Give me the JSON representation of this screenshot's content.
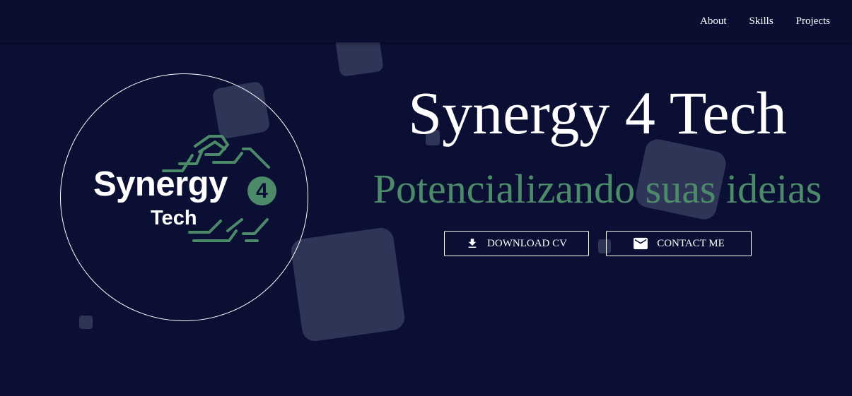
{
  "nav": {
    "links": [
      "About",
      "Skills",
      "Projects"
    ]
  },
  "logo": {
    "word": "Synergy",
    "badge": "4",
    "sub": "Tech"
  },
  "hero": {
    "title": "Synergy 4 Tech",
    "subtitle": "Potencializando suas ideias"
  },
  "buttons": {
    "download_label": "DOWNLOAD CV",
    "contact_label": "CONTACT ME"
  },
  "icons": {
    "download": "download-icon",
    "contact": "mail-icon"
  },
  "colors": {
    "background": "#0a0f33",
    "navbar": "#0a0f31",
    "accent": "#4c8a6a",
    "text": "#ffffff",
    "decor": "#2f3557"
  }
}
